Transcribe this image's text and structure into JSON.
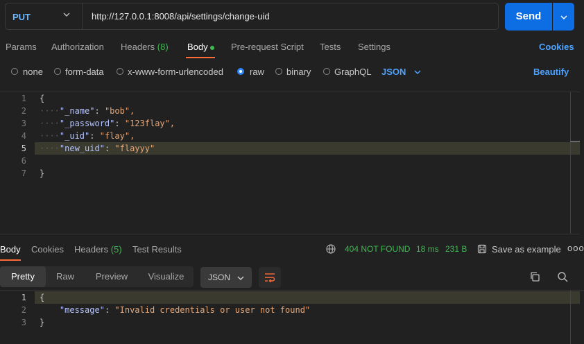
{
  "request": {
    "method": "PUT",
    "url": "http://127.0.0.1:8008/api/settings/change-uid",
    "send_label": "Send"
  },
  "request_tabs": {
    "params": "Params",
    "authorization": "Authorization",
    "headers": "Headers",
    "headers_count": "(8)",
    "body": "Body",
    "pre_request": "Pre-request Script",
    "tests": "Tests",
    "settings": "Settings",
    "cookies": "Cookies"
  },
  "body_types": {
    "none": "none",
    "form_data": "form-data",
    "urlencoded": "x-www-form-urlencoded",
    "raw": "raw",
    "binary": "binary",
    "graphql": "GraphQL",
    "format": "JSON",
    "beautify": "Beautify",
    "selected": "raw"
  },
  "editor": {
    "line_numbers": [
      "1",
      "2",
      "3",
      "4",
      "5",
      "6",
      "7"
    ],
    "open_brace": "{",
    "close_brace": "}",
    "lines": [
      {
        "key": "\"_name\"",
        "value": "\"bob\","
      },
      {
        "key": "\"_password\"",
        "value": "\"123flay\","
      },
      {
        "key": "\"_uid\"",
        "value": "\"flay\","
      },
      {
        "key": "\"new_uid\"",
        "value": "\"flayyy\""
      }
    ]
  },
  "response_tabs": {
    "body": "Body",
    "cookies": "Cookies",
    "headers": "Headers",
    "headers_count": "(5)",
    "test_results": "Test Results"
  },
  "response_meta": {
    "status": "404 NOT FOUND",
    "time": "18 ms",
    "size": "231 B",
    "save_example": "Save as example",
    "more": "ooo"
  },
  "view_modes": {
    "pretty": "Pretty",
    "raw": "Raw",
    "preview": "Preview",
    "visualize": "Visualize",
    "format": "JSON"
  },
  "response_body": {
    "line_numbers": [
      "1",
      "2",
      "3"
    ],
    "open_brace": "{",
    "key": "\"message\"",
    "value": "\"Invalid credentials or user not found\"",
    "close_brace": "}"
  },
  "colors": {
    "accent": "#ff6c37",
    "send": "#0d6de3",
    "link": "#4ea2ff",
    "success_status": "#3fb950",
    "background": "#212121"
  }
}
